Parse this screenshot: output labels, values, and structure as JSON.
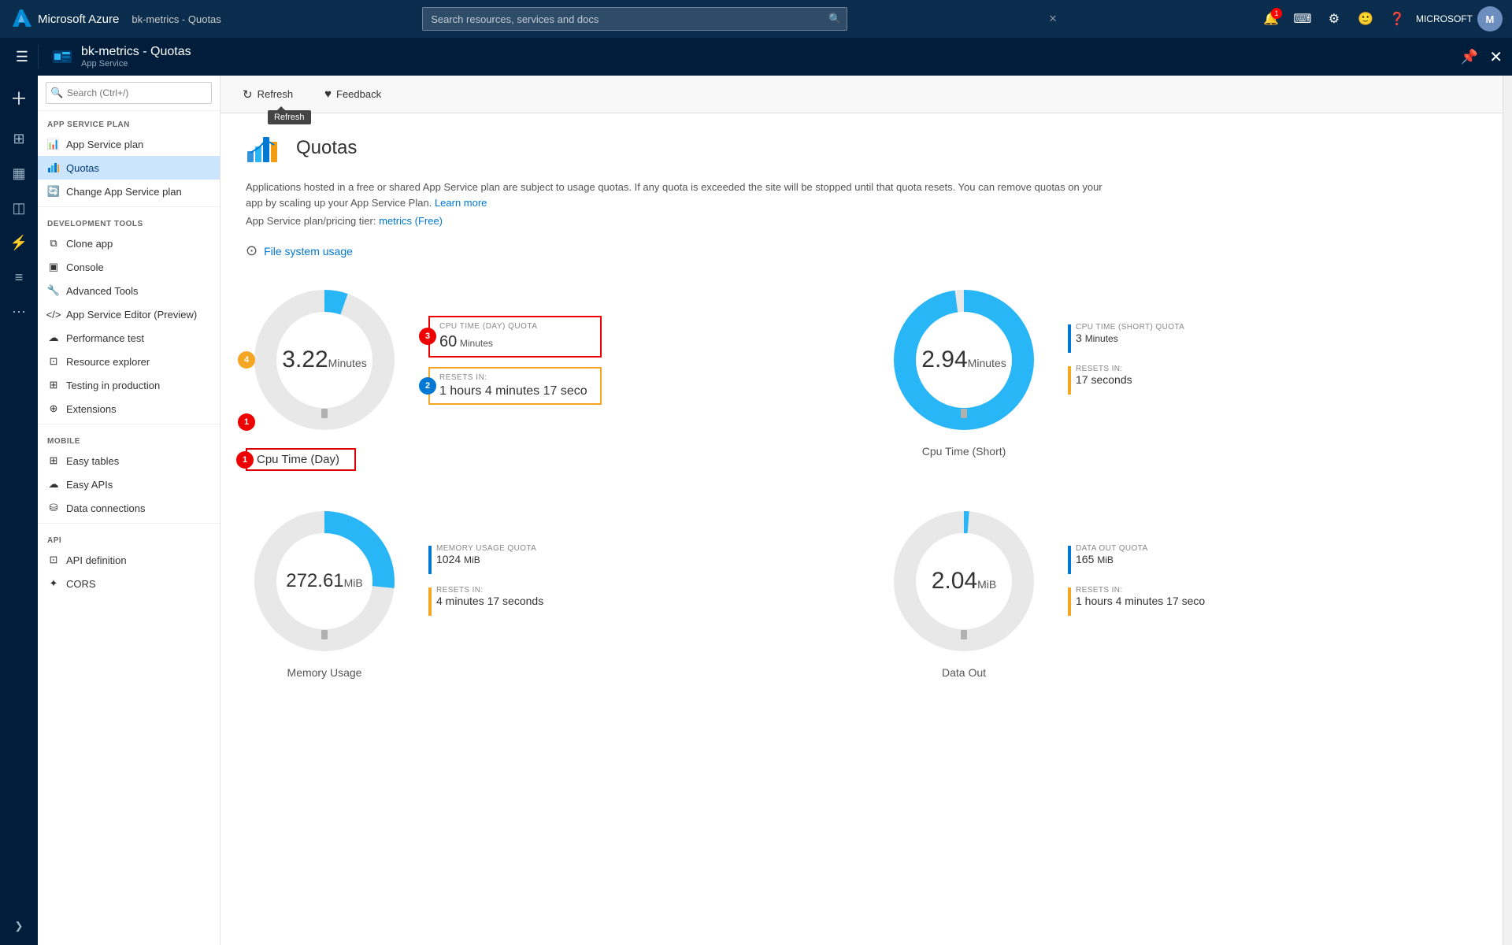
{
  "topbar": {
    "brand": "Microsoft Azure",
    "breadcrumb": "bk-metrics - Quotas",
    "search_placeholder": "Search resources, services and docs",
    "notification_count": "1",
    "user_label": "MICROSOFT"
  },
  "navbar2": {
    "app_title": "bk-metrics - Quotas",
    "app_subtitle": "App Service"
  },
  "toolbar": {
    "refresh_label": "Refresh",
    "feedback_label": "Feedback",
    "tooltip": "Refresh"
  },
  "sidebar": {
    "search_placeholder": "Search (Ctrl+/)",
    "sections": [
      {
        "label": "APP SERVICE PLAN",
        "items": [
          {
            "label": "App Service plan",
            "icon": "chart"
          },
          {
            "label": "Quotas",
            "icon": "quota",
            "active": true
          },
          {
            "label": "Change App Service plan",
            "icon": "change"
          }
        ]
      },
      {
        "label": "DEVELOPMENT TOOLS",
        "items": [
          {
            "label": "Clone app",
            "icon": "clone"
          },
          {
            "label": "Console",
            "icon": "console"
          },
          {
            "label": "Advanced Tools",
            "icon": "advanced"
          },
          {
            "label": "App Service Editor (Preview)",
            "icon": "editor"
          },
          {
            "label": "Performance test",
            "icon": "perf"
          },
          {
            "label": "Resource explorer",
            "icon": "resource"
          },
          {
            "label": "Testing in production",
            "icon": "testing"
          },
          {
            "label": "Extensions",
            "icon": "ext"
          }
        ]
      },
      {
        "label": "MOBILE",
        "items": [
          {
            "label": "Easy tables",
            "icon": "tables"
          },
          {
            "label": "Easy APIs",
            "icon": "apis"
          },
          {
            "label": "Data connections",
            "icon": "data"
          }
        ]
      },
      {
        "label": "API",
        "items": [
          {
            "label": "API definition",
            "icon": "apidef"
          },
          {
            "label": "CORS",
            "icon": "cors"
          }
        ]
      }
    ]
  },
  "page": {
    "title": "Quotas",
    "description": "Applications hosted in a free or shared App Service plan are subject to usage quotas. If any quota is exceeded the site will be stopped until that quota resets. You can remove quotas on your app by scaling up your App Service Plan.",
    "learn_more": "Learn more",
    "plan_info": "App Service plan/pricing tier:",
    "plan_link": "metrics (Free)",
    "file_usage": "File system usage"
  },
  "charts": {
    "cpu_day": {
      "title": "Cpu Time (Day)",
      "value": "3.22",
      "unit": "Minutes",
      "quota_label": "CPU TIME (DAY) QUOTA",
      "quota_value": "60",
      "quota_unit": "Minutes",
      "resets_label": "RESETS IN:",
      "resets_value": "1 hours 4 minutes 17 seco",
      "percent": 5.4,
      "badge1": "1",
      "badge2": "2",
      "badge3": "3",
      "badge4": "4"
    },
    "cpu_short": {
      "title": "Cpu Time (Short)",
      "value": "2.94",
      "unit": "Minutes",
      "quota_label": "CPU TIME (SHORT) QUOTA",
      "quota_value": "3",
      "quota_unit": "Minutes",
      "resets_label": "RESETS IN:",
      "resets_value": "17 seconds",
      "percent": 98
    },
    "memory": {
      "title": "Memory Usage",
      "value": "272.61",
      "unit": "MiB",
      "quota_label": "MEMORY USAGE QUOTA",
      "quota_value": "1024",
      "quota_unit": "MiB",
      "resets_label": "RESETS IN:",
      "resets_value": "4 minutes 17 seconds",
      "percent": 26.6
    },
    "data_out": {
      "title": "Data Out",
      "value": "2.04",
      "unit": "MiB",
      "quota_label": "DATA OUT QUOTA",
      "quota_value": "165",
      "quota_unit": "MiB",
      "resets_label": "RESETS IN:",
      "resets_value": "1 hours 4 minutes 17 seco",
      "percent": 1.2
    }
  }
}
